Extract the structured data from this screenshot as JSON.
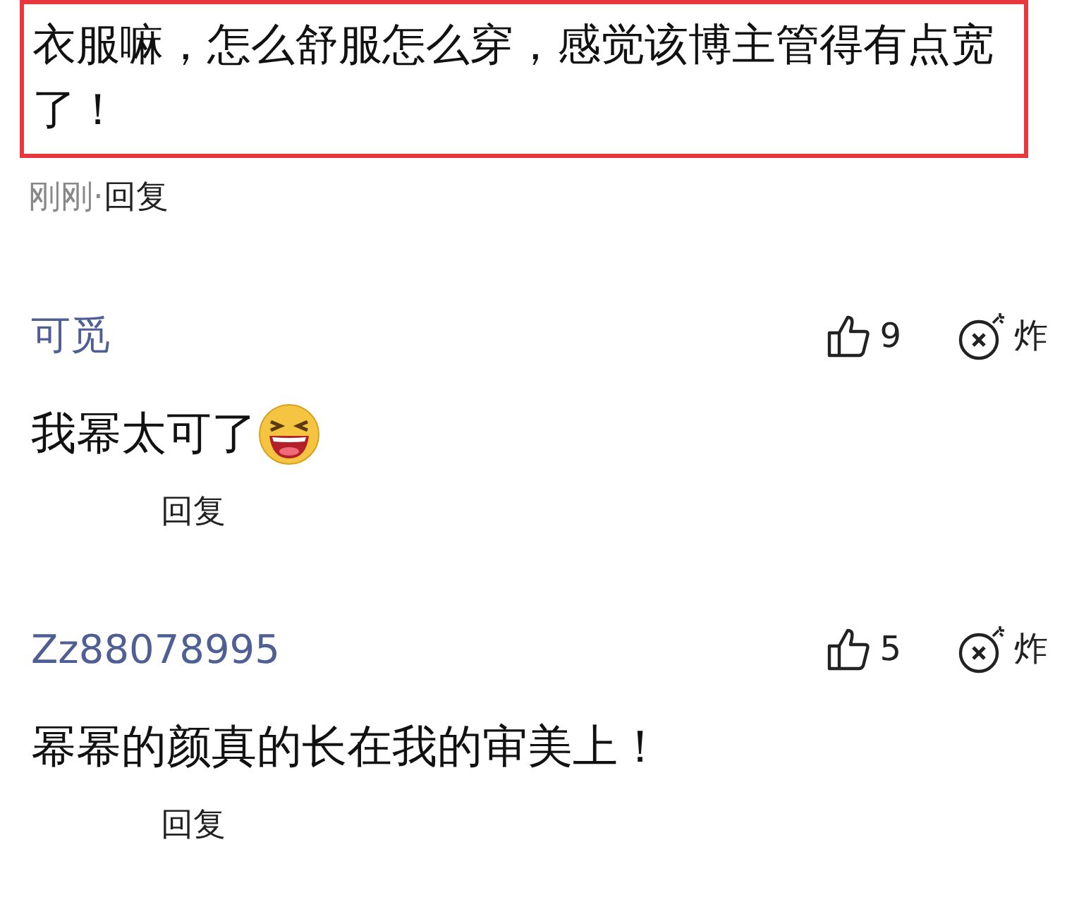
{
  "highlighted_comment": {
    "text": "衣服嘛，怎么舒服怎么穿，感觉该博主管得有点宽了！",
    "time": "刚刚·",
    "reply": "回复"
  },
  "comments": [
    {
      "username": "可觅",
      "likes": "9",
      "bomb": "炸",
      "text": "我幂太可了",
      "kind": "emoji",
      "reply": "回复"
    },
    {
      "username": "Zz88078995",
      "likes": "5",
      "bomb": "炸",
      "text": "幂幂的颜真的长在我的审美上！",
      "kind": "plain",
      "reply": "回复"
    }
  ]
}
